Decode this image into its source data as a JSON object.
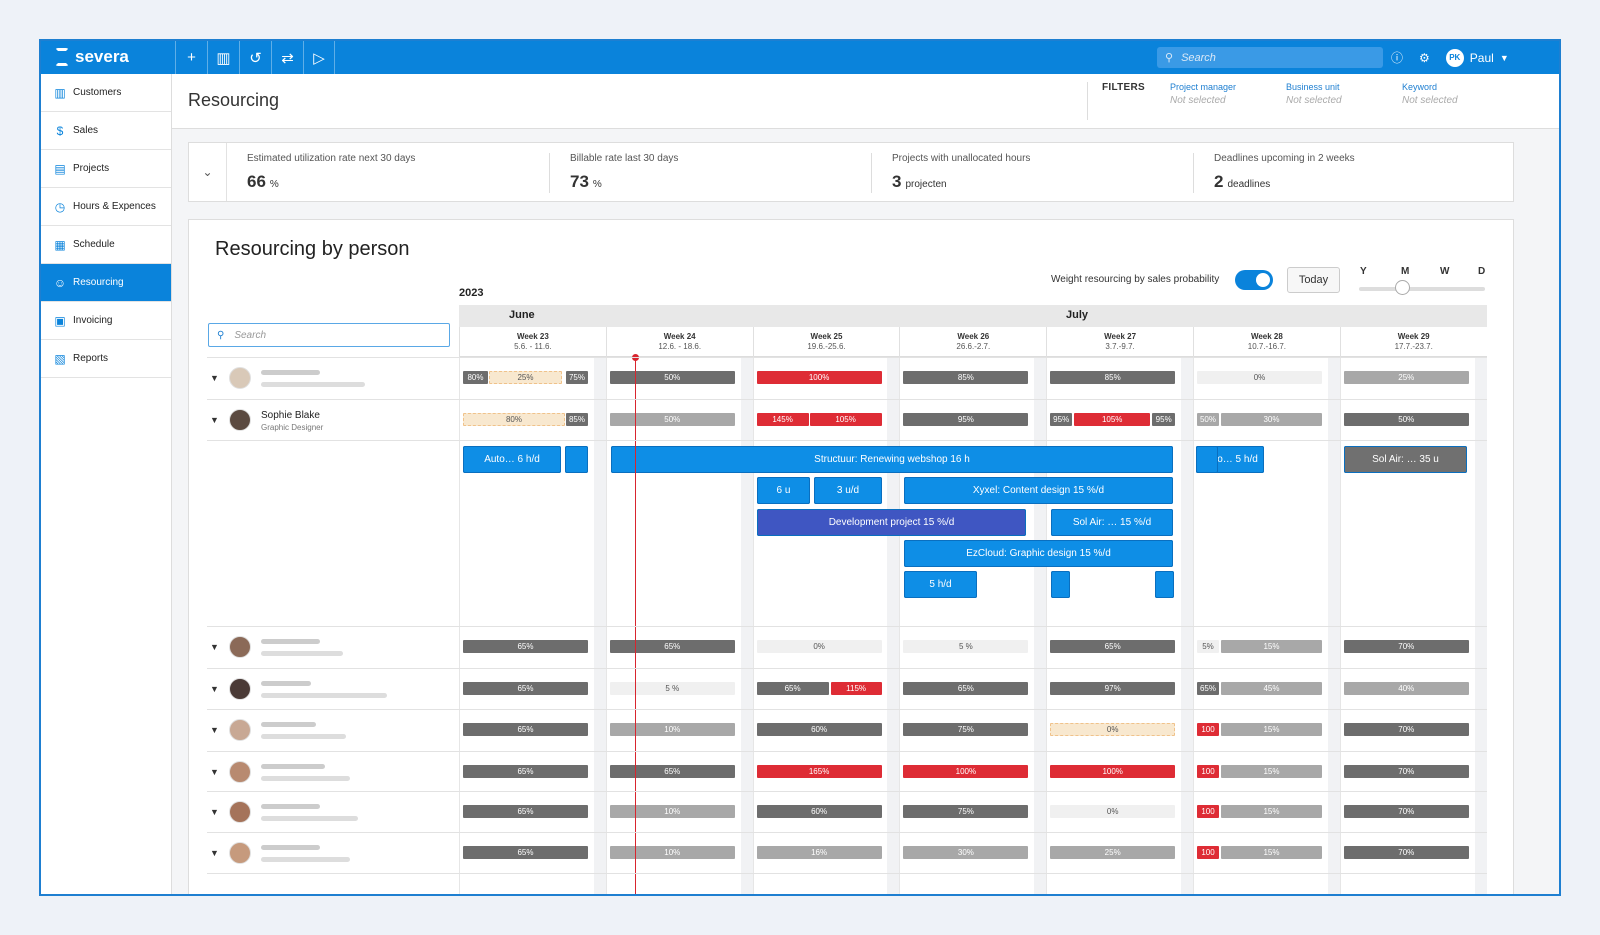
{
  "app": {
    "brand": "severa"
  },
  "topbar": {
    "icons": [
      "plus-icon",
      "chart-icon",
      "history-icon",
      "swap-icon",
      "play-icon"
    ],
    "search_placeholder": "Search",
    "user_initials": "PK",
    "user_name": "Paul"
  },
  "sidebar": {
    "items": [
      {
        "label": "Customers",
        "icon": "building-icon"
      },
      {
        "label": "Sales",
        "icon": "dollar-icon"
      },
      {
        "label": "Projects",
        "icon": "folder-icon"
      },
      {
        "label": "Hours & Expences",
        "icon": "clock-icon"
      },
      {
        "label": "Schedule",
        "icon": "calendar-icon"
      },
      {
        "label": "Resourcing",
        "icon": "users-icon",
        "active": true
      },
      {
        "label": "Invoicing",
        "icon": "invoice-icon"
      },
      {
        "label": "Reports",
        "icon": "report-icon"
      }
    ]
  },
  "header": {
    "title": "Resourcing",
    "filters_label": "FILTERS",
    "filters": [
      {
        "label": "Project manager",
        "value": "Not selected"
      },
      {
        "label": "Business unit",
        "value": "Not selected"
      },
      {
        "label": "Keyword",
        "value": "Not selected"
      }
    ]
  },
  "stats": [
    {
      "label": "Estimated utilization rate next 30 days",
      "value": "66",
      "unit": "%"
    },
    {
      "label": "Billable rate last 30 days",
      "value": "73",
      "unit": "%"
    },
    {
      "label": "Projects with unallocated hours",
      "value": "3",
      "unit": "projecten"
    },
    {
      "label": "Deadlines upcoming in 2 weeks",
      "value": "2",
      "unit": "deadlines"
    }
  ],
  "panel": {
    "title": "Resourcing by person",
    "weight_label": "Weight resourcing by sales probability",
    "today_label": "Today",
    "zoom": [
      "Y",
      "M",
      "W",
      "D"
    ],
    "year": "2023",
    "search_placeholder": "Search",
    "months": [
      "June",
      "July"
    ]
  },
  "weeks": [
    {
      "name": "Week 23",
      "dates": "5.6. - 11.6."
    },
    {
      "name": "Week 24",
      "dates": "12.6. - 18.6."
    },
    {
      "name": "Week 25",
      "dates": "19.6.-25.6."
    },
    {
      "name": "Week 26",
      "dates": "26.6.-2.7."
    },
    {
      "name": "Week 27",
      "dates": "3.7.-9.7."
    },
    {
      "name": "Week 28",
      "dates": "10.7.-16.7."
    },
    {
      "name": "Week 29",
      "dates": "17.7.-23.7."
    }
  ],
  "person": {
    "name": "Sophie Blake",
    "role": "Graphic Designer"
  },
  "rows": [
    [
      [
        "80%",
        "25%",
        "75%"
      ],
      [
        "50%"
      ],
      [
        "100%"
      ],
      [
        "85%"
      ],
      [
        "85%"
      ],
      [
        "0%"
      ],
      [
        "25%"
      ]
    ],
    [
      [
        "80%",
        "85%"
      ],
      [
        "50%"
      ],
      [
        "145%",
        "105%"
      ],
      [
        "95%"
      ],
      [
        "95%",
        "105%",
        "95%"
      ],
      [
        "50%",
        "30%"
      ],
      [
        "50%"
      ]
    ],
    [
      [
        "65%"
      ],
      [
        "65%"
      ],
      [
        "0%"
      ],
      [
        "5 %"
      ],
      [
        "65%"
      ],
      [
        "5%",
        "15%"
      ],
      [
        "70%"
      ]
    ],
    [
      [
        "65%"
      ],
      [
        "5 %"
      ],
      [
        "65%",
        "115%"
      ],
      [
        "65%"
      ],
      [
        "97%"
      ],
      [
        "65%",
        "45%"
      ],
      [
        "40%"
      ]
    ],
    [
      [
        "65%"
      ],
      [
        "10%"
      ],
      [
        "60%"
      ],
      [
        "75%"
      ],
      [
        "0%"
      ],
      [
        "100",
        "15%"
      ],
      [
        "70%"
      ]
    ],
    [
      [
        "65%"
      ],
      [
        "65%"
      ],
      [
        "165%"
      ],
      [
        "100%"
      ],
      [
        "100%"
      ],
      [
        "100",
        "15%"
      ],
      [
        "70%"
      ]
    ],
    [
      [
        "65%"
      ],
      [
        "10%"
      ],
      [
        "60%"
      ],
      [
        "75%"
      ],
      [
        "0%"
      ],
      [
        "100",
        "15%"
      ],
      [
        "70%"
      ]
    ],
    [
      [
        "65%"
      ],
      [
        "10%"
      ],
      [
        "16%"
      ],
      [
        "30%"
      ],
      [
        "25%"
      ],
      [
        "100",
        "15%"
      ],
      [
        "70%"
      ]
    ]
  ],
  "tasks": [
    "Auto… 6 h/d",
    "Structuur: Renewing webshop  16 h",
    "Auto… 5 h/d",
    "Sol Air: … 35 u",
    "6 u",
    "3 u/d",
    "Xyxel: Content design 15 %/d",
    "Development project 15 %/d",
    "Sol Air: … 15 %/d",
    "EzCloud: Graphic design 15 %/d",
    "5 h/d"
  ]
}
